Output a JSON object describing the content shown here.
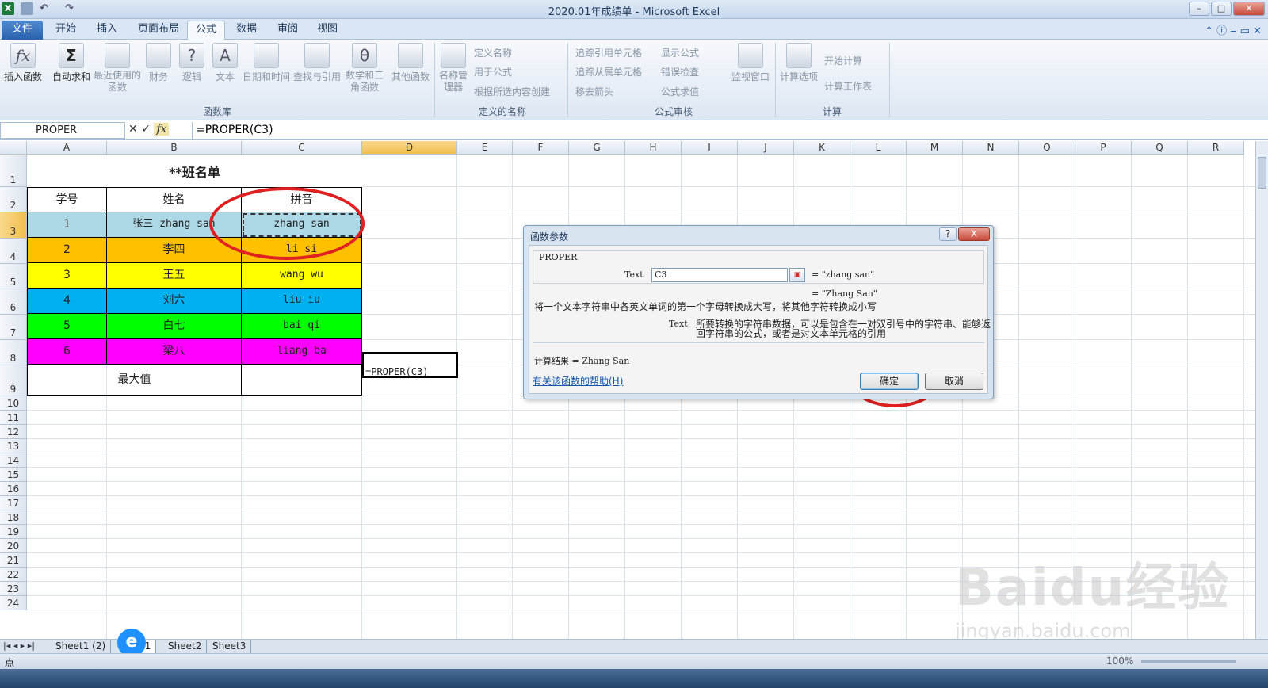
{
  "window": {
    "title": "2020.01年成绩单 - Microsoft Excel"
  },
  "tabs": [
    "文件",
    "开始",
    "插入",
    "页面布局",
    "公式",
    "数据",
    "审阅",
    "视图"
  ],
  "ribbon": {
    "insert_function": "插入函数",
    "autosum": "自动求和",
    "recent": "最近使用的函数",
    "finance": "财务",
    "logic": "逻辑",
    "text": "文本",
    "datetime": "日期和时间",
    "lookup": "查找与引用",
    "math": "数学和三角函数",
    "other": "其他函数",
    "name_mgr": "名称管理器",
    "define_name": "定义名称",
    "use_in_formula": "用于公式",
    "create_from_sel": "根据所选内容创建",
    "trace_prec": "追踪引用单元格",
    "trace_dep": "追踪从属单元格",
    "remove_arrows": "移去箭头",
    "show_formulas": "显示公式",
    "error_check": "错误检查",
    "eval_formula": "公式求值",
    "watch": "监视窗口",
    "calc_options": "计算选项",
    "calc_now": "开始计算",
    "calc_sheet": "计算工作表",
    "group_lib": "函数库",
    "group_names": "定义的名称",
    "group_audit": "公式审核",
    "group_calc": "计算"
  },
  "formula_bar": {
    "name_box": "PROPER",
    "formula": "=PROPER(C3)"
  },
  "columns": [
    "A",
    "B",
    "C",
    "D",
    "E",
    "F",
    "G",
    "H",
    "I",
    "J",
    "K",
    "L",
    "M",
    "N",
    "O",
    "P",
    "Q",
    "R"
  ],
  "rows": [
    "1",
    "2",
    "3",
    "4",
    "5",
    "6",
    "7",
    "8",
    "9",
    "10",
    "11",
    "12",
    "13",
    "14",
    "15",
    "16",
    "17",
    "18",
    "19",
    "20",
    "21",
    "22",
    "23",
    "24"
  ],
  "table": {
    "title": "**班名单",
    "headers": [
      "学号",
      "姓名",
      "拼音"
    ],
    "rows": [
      {
        "id": "1",
        "name": "张三 zhang san",
        "pinyin": "zhang san",
        "color": "#add8e6"
      },
      {
        "id": "2",
        "name": "李四",
        "pinyin": "li si",
        "color": "#ffc000"
      },
      {
        "id": "3",
        "name": "王五",
        "pinyin": "wang wu",
        "color": "#ffff00"
      },
      {
        "id": "4",
        "name": "刘六",
        "pinyin": "liu iu",
        "color": "#00b0f0"
      },
      {
        "id": "5",
        "name": "白七",
        "pinyin": "bai qi",
        "color": "#00ff00"
      },
      {
        "id": "6",
        "name": "梁八",
        "pinyin": "liang ba",
        "color": "#ff00ff"
      }
    ],
    "max_label": "最大值",
    "editing_cell": "=PROPER(C3)"
  },
  "dialog": {
    "title": "函数参数",
    "func": "PROPER",
    "arg_label": "Text",
    "arg_value": "C3",
    "arg_result": "= \"zhang san\"",
    "func_result": "= \"Zhang San\"",
    "description": "将一个文本字符串中各英文单词的第一个字母转换成大写，将其他字符转换成小写",
    "arg_desc_label": "Text",
    "arg_desc_1": "所要转换的字符串数据，可以是包含在一对双引号中的字符串、能够返",
    "arg_desc_2": "回字符串的公式，或者是对文本单元格的引用",
    "calc_result": "计算结果 =  Zhang San",
    "help_link": "有关该函数的帮助(H)",
    "ok": "确定",
    "cancel": "取消",
    "help_btn": "?",
    "close_btn": "X"
  },
  "sheets": [
    "Sheet1 (2)",
    "t1",
    "Sheet2",
    "Sheet3"
  ],
  "status": {
    "mode": "点",
    "zoom": "100%"
  },
  "watermark": {
    "main": "Baidu经验",
    "sub": "jingyan.baidu.com"
  },
  "highlight_color": "#e02020"
}
